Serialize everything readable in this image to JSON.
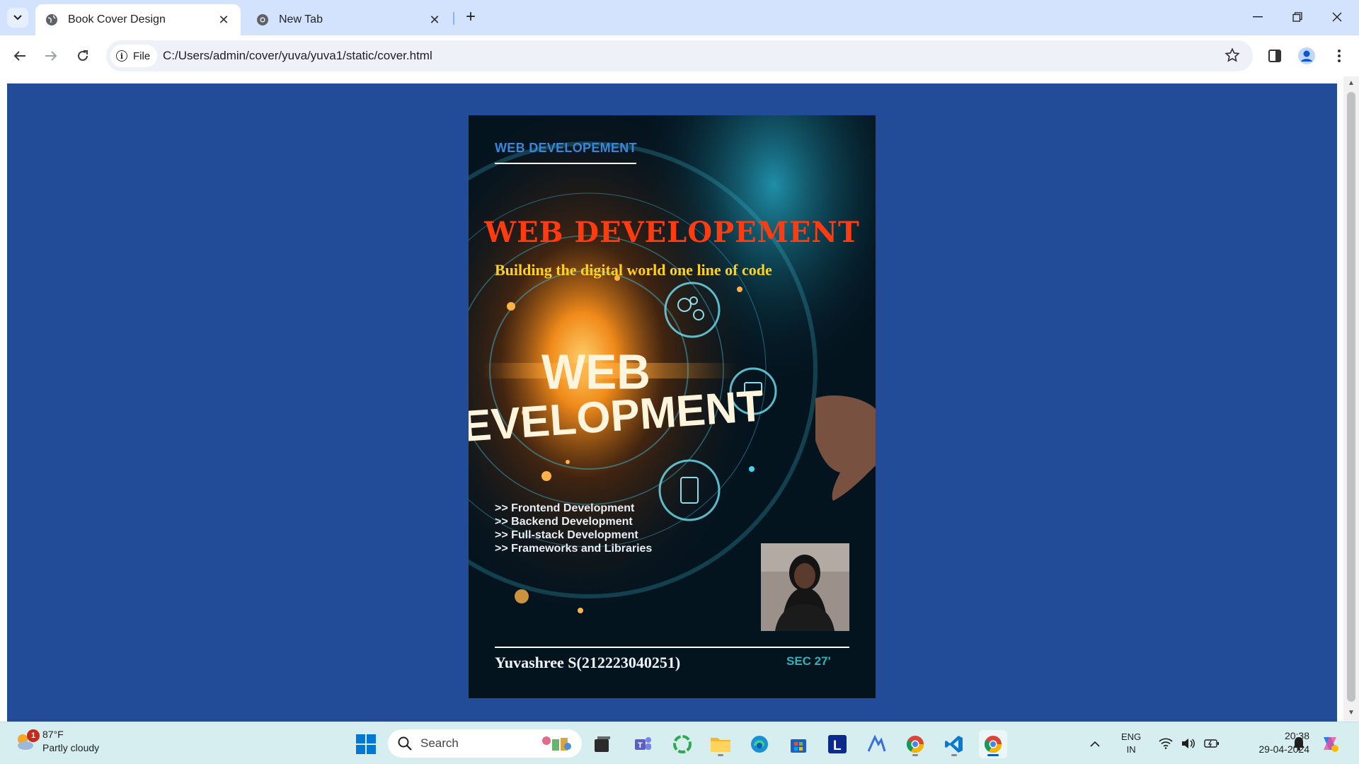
{
  "browser": {
    "tabs": [
      {
        "title": "Book Cover Design",
        "active": true
      },
      {
        "title": "New Tab",
        "active": false
      }
    ],
    "site_chip": "File",
    "url": "C:/Users/admin/cover/yuva/yuva1/static/cover.html"
  },
  "page": {
    "background": "#224c98",
    "cover": {
      "top_label": "WEB DEVELOPEMENT",
      "title": "WEB  DEVELOPEMENT",
      "subtitle": "Building the digital world one line of code",
      "image_text_line1": "WEB",
      "image_text_line2": "EVELOPMENT",
      "topics": [
        ">> Frontend Development",
        ">> Backend Development",
        ">> Full-stack Development",
        ">> Frameworks and Libraries"
      ],
      "author": "Yuvashree S(212223040251)",
      "section": "SEC 27'",
      "colors": {
        "title": "#ff3b0f",
        "subtitle": "#ffd21a",
        "top_label": "#3a86d6",
        "section": "#2cb4b9"
      }
    }
  },
  "taskbar": {
    "weather": {
      "temp": "87°F",
      "condition": "Partly cloudy",
      "badge": "1"
    },
    "search_placeholder": "Search",
    "apps": [
      "start-icon",
      "file-explorer-icon",
      "teams-icon",
      "app-ring-icon",
      "folder-icon",
      "edge-icon",
      "store-icon",
      "l-app-icon",
      "arc-icon",
      "chrome-icon",
      "vscode-icon",
      "chrome-active-icon"
    ],
    "language": {
      "line1": "ENG",
      "line2": "IN"
    },
    "time": "20:38",
    "date": "29-04-2024"
  }
}
